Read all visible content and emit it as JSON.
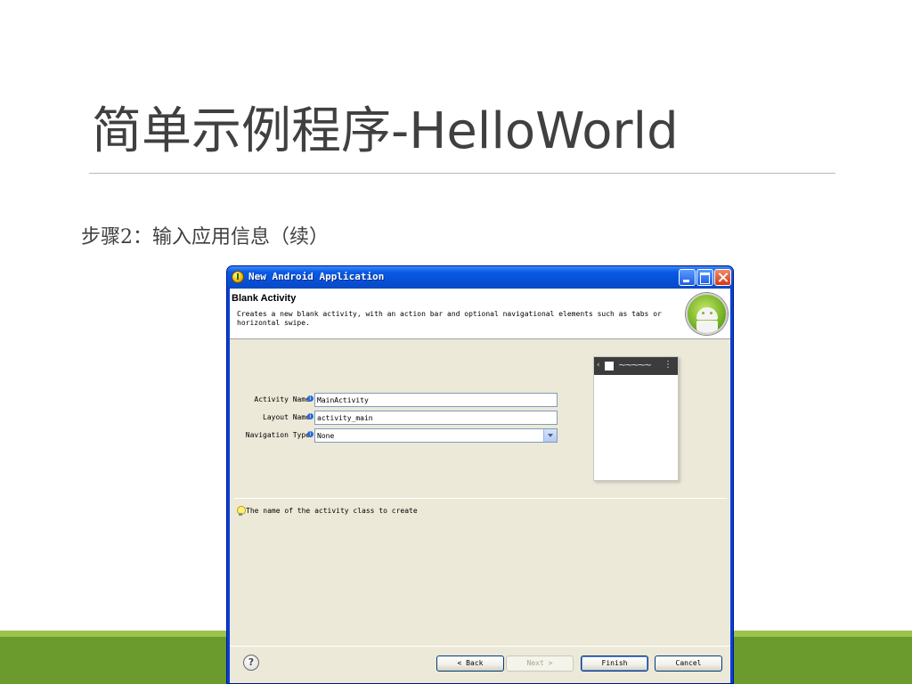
{
  "slide": {
    "title": "简单示例程序-HelloWorld",
    "subtitle": "步骤2：输入应用信息（续）"
  },
  "dialog": {
    "window_title": "New Android Application",
    "header_title": "Blank Activity",
    "header_description": "Creates a new blank activity, with an action bar and optional navigational elements such as tabs or horizontal swipe.",
    "fields": {
      "activity_name_label": "Activity Name",
      "activity_name_value": "MainActivity",
      "layout_name_label": "Layout Name",
      "layout_name_value": "activity_main",
      "navigation_type_label": "Navigation Type",
      "navigation_type_value": "None"
    },
    "hint_text": "The name of the activity class to create",
    "buttons": {
      "help": "?",
      "back": "< Back",
      "next": "Next >",
      "finish": "Finish",
      "cancel": "Cancel"
    },
    "preview": {
      "back_glyph": "‹",
      "title_glyph": "~~~~~",
      "menu_glyph": "⋮"
    }
  },
  "colors": {
    "slide_accent_green": "#6b9b2c",
    "slide_accent_light_green": "#9bc34f",
    "xp_titlebar_blue": "#0a5be6",
    "dialog_background": "#ece9d8"
  },
  "icons": [
    "info-icon",
    "android-logo-icon",
    "lightbulb-icon",
    "help-icon",
    "minimize-icon",
    "maximize-icon",
    "close-icon",
    "chevron-down-icon"
  ]
}
